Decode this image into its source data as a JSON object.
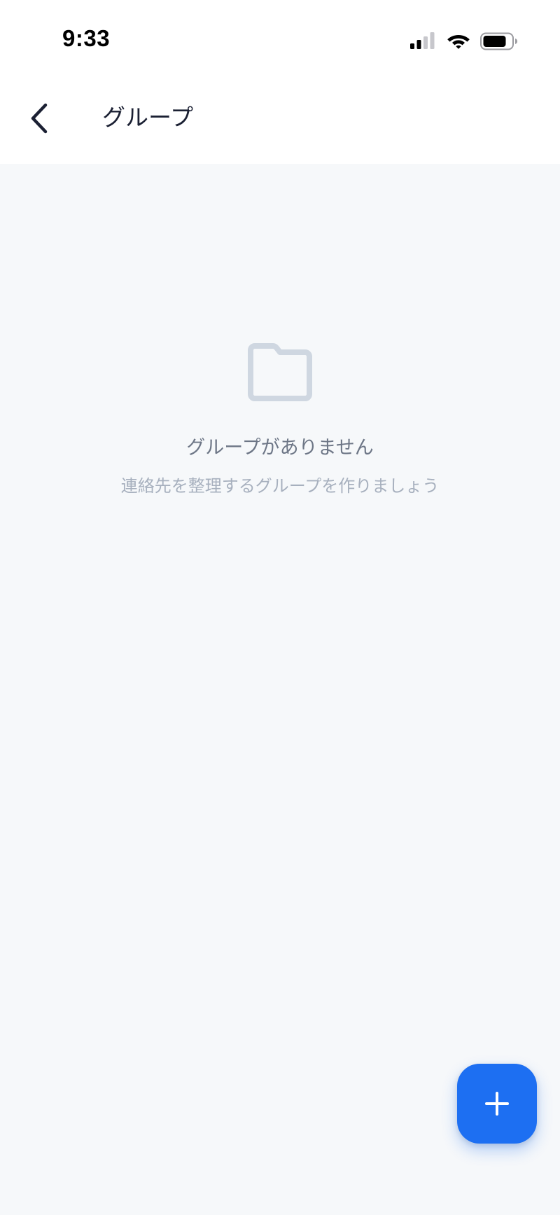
{
  "status_bar": {
    "time": "9:33",
    "icons": [
      "signal-icon",
      "wifi-icon",
      "battery-icon"
    ]
  },
  "header": {
    "back_icon": "chevron-left-icon",
    "title": "グループ"
  },
  "empty_state": {
    "icon": "folder-icon",
    "title": "グループがありません",
    "subtitle": "連絡先を整理するグループを作りましょう"
  },
  "fab": {
    "icon": "plus-icon"
  },
  "colors": {
    "accent": "#1d6ff2",
    "background": "#f6f8fa",
    "header_background": "#ffffff",
    "title_text": "#1b2033",
    "empty_title_text": "#6d7686",
    "empty_subtitle_text": "#a7b0be",
    "folder_icon": "#cfd7e1"
  }
}
